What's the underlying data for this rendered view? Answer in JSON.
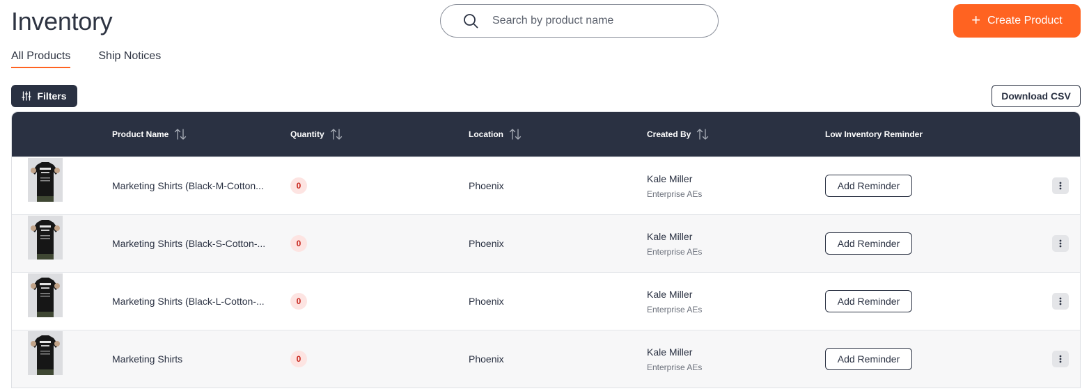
{
  "header": {
    "title": "Inventory",
    "search_placeholder": "Search by product name",
    "create_label": "Create Product"
  },
  "tabs": [
    {
      "label": "All Products",
      "active": true
    },
    {
      "label": "Ship Notices",
      "active": false
    }
  ],
  "toolbar": {
    "filters_label": "Filters",
    "csv_label": "Download CSV"
  },
  "table": {
    "columns": [
      "Product Name",
      "Quantity",
      "Location",
      "Created By",
      "Low Inventory Reminder"
    ],
    "rows": [
      {
        "product": "Marketing Shirts (Black-M-Cotton...",
        "quantity": "0",
        "location": "Phoenix",
        "creator": "Kale Miller",
        "team": "Enterprise AEs",
        "reminder": "Add Reminder"
      },
      {
        "product": "Marketing Shirts (Black-S-Cotton-...",
        "quantity": "0",
        "location": "Phoenix",
        "creator": "Kale Miller",
        "team": "Enterprise AEs",
        "reminder": "Add Reminder"
      },
      {
        "product": "Marketing Shirts (Black-L-Cotton-...",
        "quantity": "0",
        "location": "Phoenix",
        "creator": "Kale Miller",
        "team": "Enterprise AEs",
        "reminder": "Add Reminder"
      },
      {
        "product": "Marketing Shirts",
        "quantity": "0",
        "location": "Phoenix",
        "creator": "Kale Miller",
        "team": "Enterprise AEs",
        "reminder": "Add Reminder"
      }
    ]
  },
  "colors": {
    "accent": "#ff6321",
    "dark": "#2a3142",
    "badge_bg": "#fde4e2",
    "badge_text": "#c7241b"
  },
  "icons": {
    "search": "search-icon",
    "create": "plus-icon",
    "filters": "sliders-icon",
    "sort": "sort-icon",
    "more": "more-vertical-icon",
    "thumbnail": "product-thumbnail"
  }
}
